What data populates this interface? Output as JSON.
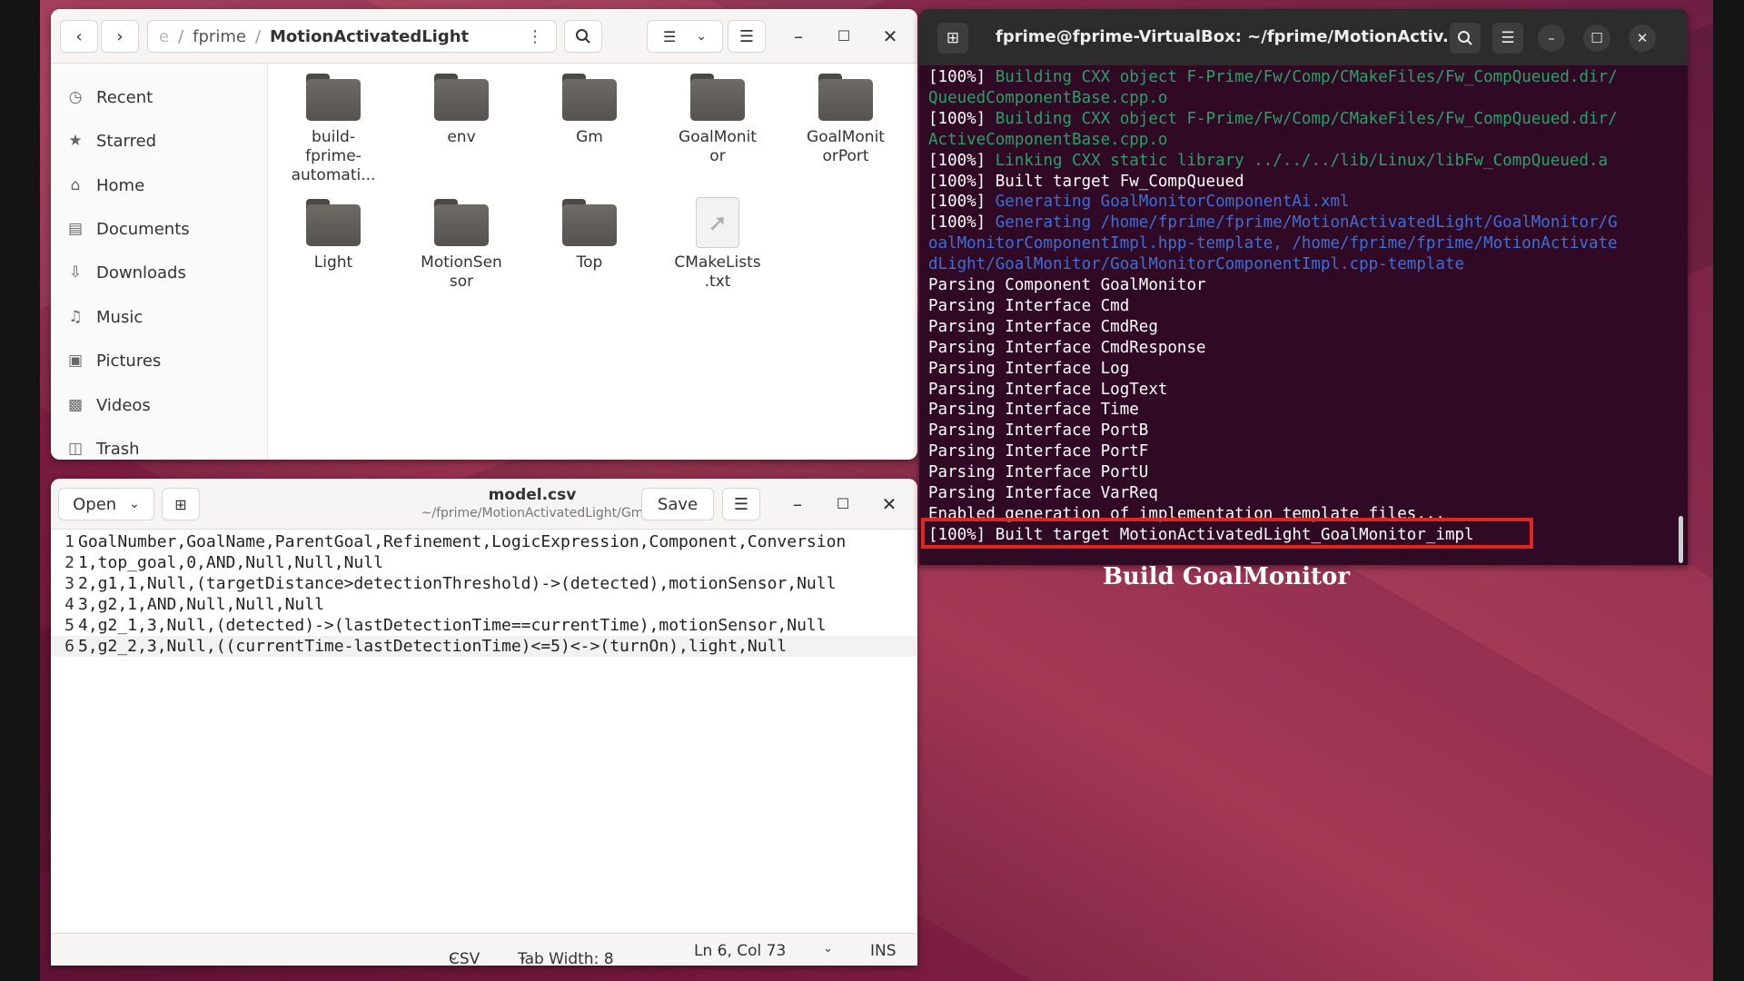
{
  "files": {
    "path": {
      "prefix": "e",
      "parent": "fprime",
      "current": "MotionActivatedLight"
    },
    "sidebar": [
      {
        "label": "Recent",
        "icon": "clock-icon"
      },
      {
        "label": "Starred",
        "icon": "star-icon"
      },
      {
        "label": "Home",
        "icon": "home-icon"
      },
      {
        "label": "Documents",
        "icon": "document-icon"
      },
      {
        "label": "Downloads",
        "icon": "download-icon"
      },
      {
        "label": "Music",
        "icon": "music-icon"
      },
      {
        "label": "Pictures",
        "icon": "pictures-icon"
      },
      {
        "label": "Videos",
        "icon": "videos-icon"
      },
      {
        "label": "Trash",
        "icon": "trash-icon"
      }
    ],
    "items": [
      {
        "line1": "build-",
        "line2": "fprime-",
        "line3": "automati..."
      },
      {
        "line1": "env"
      },
      {
        "line1": "Gm"
      },
      {
        "line1": "GoalMonit",
        "line2": "or"
      },
      {
        "line1": "GoalMonit",
        "line2": "orPort"
      },
      {
        "line1": "Light"
      },
      {
        "line1": "MotionSen",
        "line2": "sor"
      },
      {
        "line1": "Top"
      },
      {
        "line1": "CMakeLists",
        "line2": ".txt"
      }
    ]
  },
  "editor": {
    "open_label": "Open",
    "save_label": "Save",
    "title": "model.csv",
    "subtitle": "~/fprime/MotionActivatedLight/Gm",
    "lines": [
      {
        "n": "1",
        "text": "GoalNumber,GoalName,ParentGoal,Refinement,LogicExpression,Component,Conversion"
      },
      {
        "n": "2",
        "text": "1,top_goal,0,AND,Null,Null,Null"
      },
      {
        "n": "3",
        "text": "2,g1,1,Null,(targetDistance>detectionThreshold)->(detected),motionSensor,Null"
      },
      {
        "n": "4",
        "text": "3,g2,1,AND,Null,Null,Null"
      },
      {
        "n": "5",
        "text": "4,g2_1,3,Null,(detected)->(lastDetectionTime==currentTime),motionSensor,Null"
      },
      {
        "n": "6",
        "text": "5,g2_2,3,Null,((currentTime-lastDetectionTime)<=5)<->(turnOn),light,Null"
      }
    ],
    "status": {
      "lang": "CSV",
      "tab": "Tab Width: 8",
      "pos": "Ln 6, Col 73",
      "mode": "INS"
    }
  },
  "terminal": {
    "title": "fprime@fprime-VirtualBox: ~/fprime/MotionActiv...",
    "lines": [
      {
        "p": "[100%] ",
        "t": "Building CXX object F-Prime/Fw/Comp/CMakeFiles/Fw_CompQueued.dir/",
        "c": "green"
      },
      {
        "p": "",
        "t": "QueuedComponentBase.cpp.o",
        "c": "green"
      },
      {
        "p": "[100%] ",
        "t": "Building CXX object F-Prime/Fw/Comp/CMakeFiles/Fw_CompQueued.dir/",
        "c": "green"
      },
      {
        "p": "",
        "t": "ActiveComponentBase.cpp.o",
        "c": "green"
      },
      {
        "p": "[100%] ",
        "t": "Linking CXX static library ../../../lib/Linux/libFw_CompQueued.a",
        "c": "green"
      },
      {
        "p": "[100%] ",
        "t": "Built target Fw_CompQueued",
        "c": ""
      },
      {
        "p": "[100%] ",
        "t": "Generating GoalMonitorComponentAi.xml",
        "c": "blue"
      },
      {
        "p": "[100%] ",
        "t": "Generating /home/fprime/fprime/MotionActivatedLight/GoalMonitor/G",
        "c": "blue"
      },
      {
        "p": "",
        "t": "oalMonitorComponentImpl.hpp-template, /home/fprime/fprime/MotionActivate",
        "c": "blue"
      },
      {
        "p": "",
        "t": "dLight/GoalMonitor/GoalMonitorComponentImpl.cpp-template",
        "c": "blue"
      },
      {
        "p": "",
        "t": "Parsing Component GoalMonitor",
        "c": ""
      },
      {
        "p": "",
        "t": "Parsing Interface Cmd",
        "c": ""
      },
      {
        "p": "",
        "t": "Parsing Interface CmdReg",
        "c": ""
      },
      {
        "p": "",
        "t": "Parsing Interface CmdResponse",
        "c": ""
      },
      {
        "p": "",
        "t": "Parsing Interface Log",
        "c": ""
      },
      {
        "p": "",
        "t": "Parsing Interface LogText",
        "c": ""
      },
      {
        "p": "",
        "t": "Parsing Interface Time",
        "c": ""
      },
      {
        "p": "",
        "t": "Parsing Interface PortB",
        "c": ""
      },
      {
        "p": "",
        "t": "Parsing Interface PortF",
        "c": ""
      },
      {
        "p": "",
        "t": "Parsing Interface PortU",
        "c": ""
      },
      {
        "p": "",
        "t": "Parsing Interface VarReq",
        "c": ""
      },
      {
        "p": "",
        "t": "Enabled generation of implementation template files...",
        "c": ""
      },
      {
        "p": "[100%] ",
        "t": "Built target MotionActivatedLight_GoalMonitor_impl",
        "c": ""
      }
    ]
  },
  "caption": "Build GoalMonitor",
  "colors": {
    "terminal_bg": "#300a24",
    "highlight": "#e0261f",
    "green": "#26a269",
    "blue": "#3f6fd6"
  }
}
